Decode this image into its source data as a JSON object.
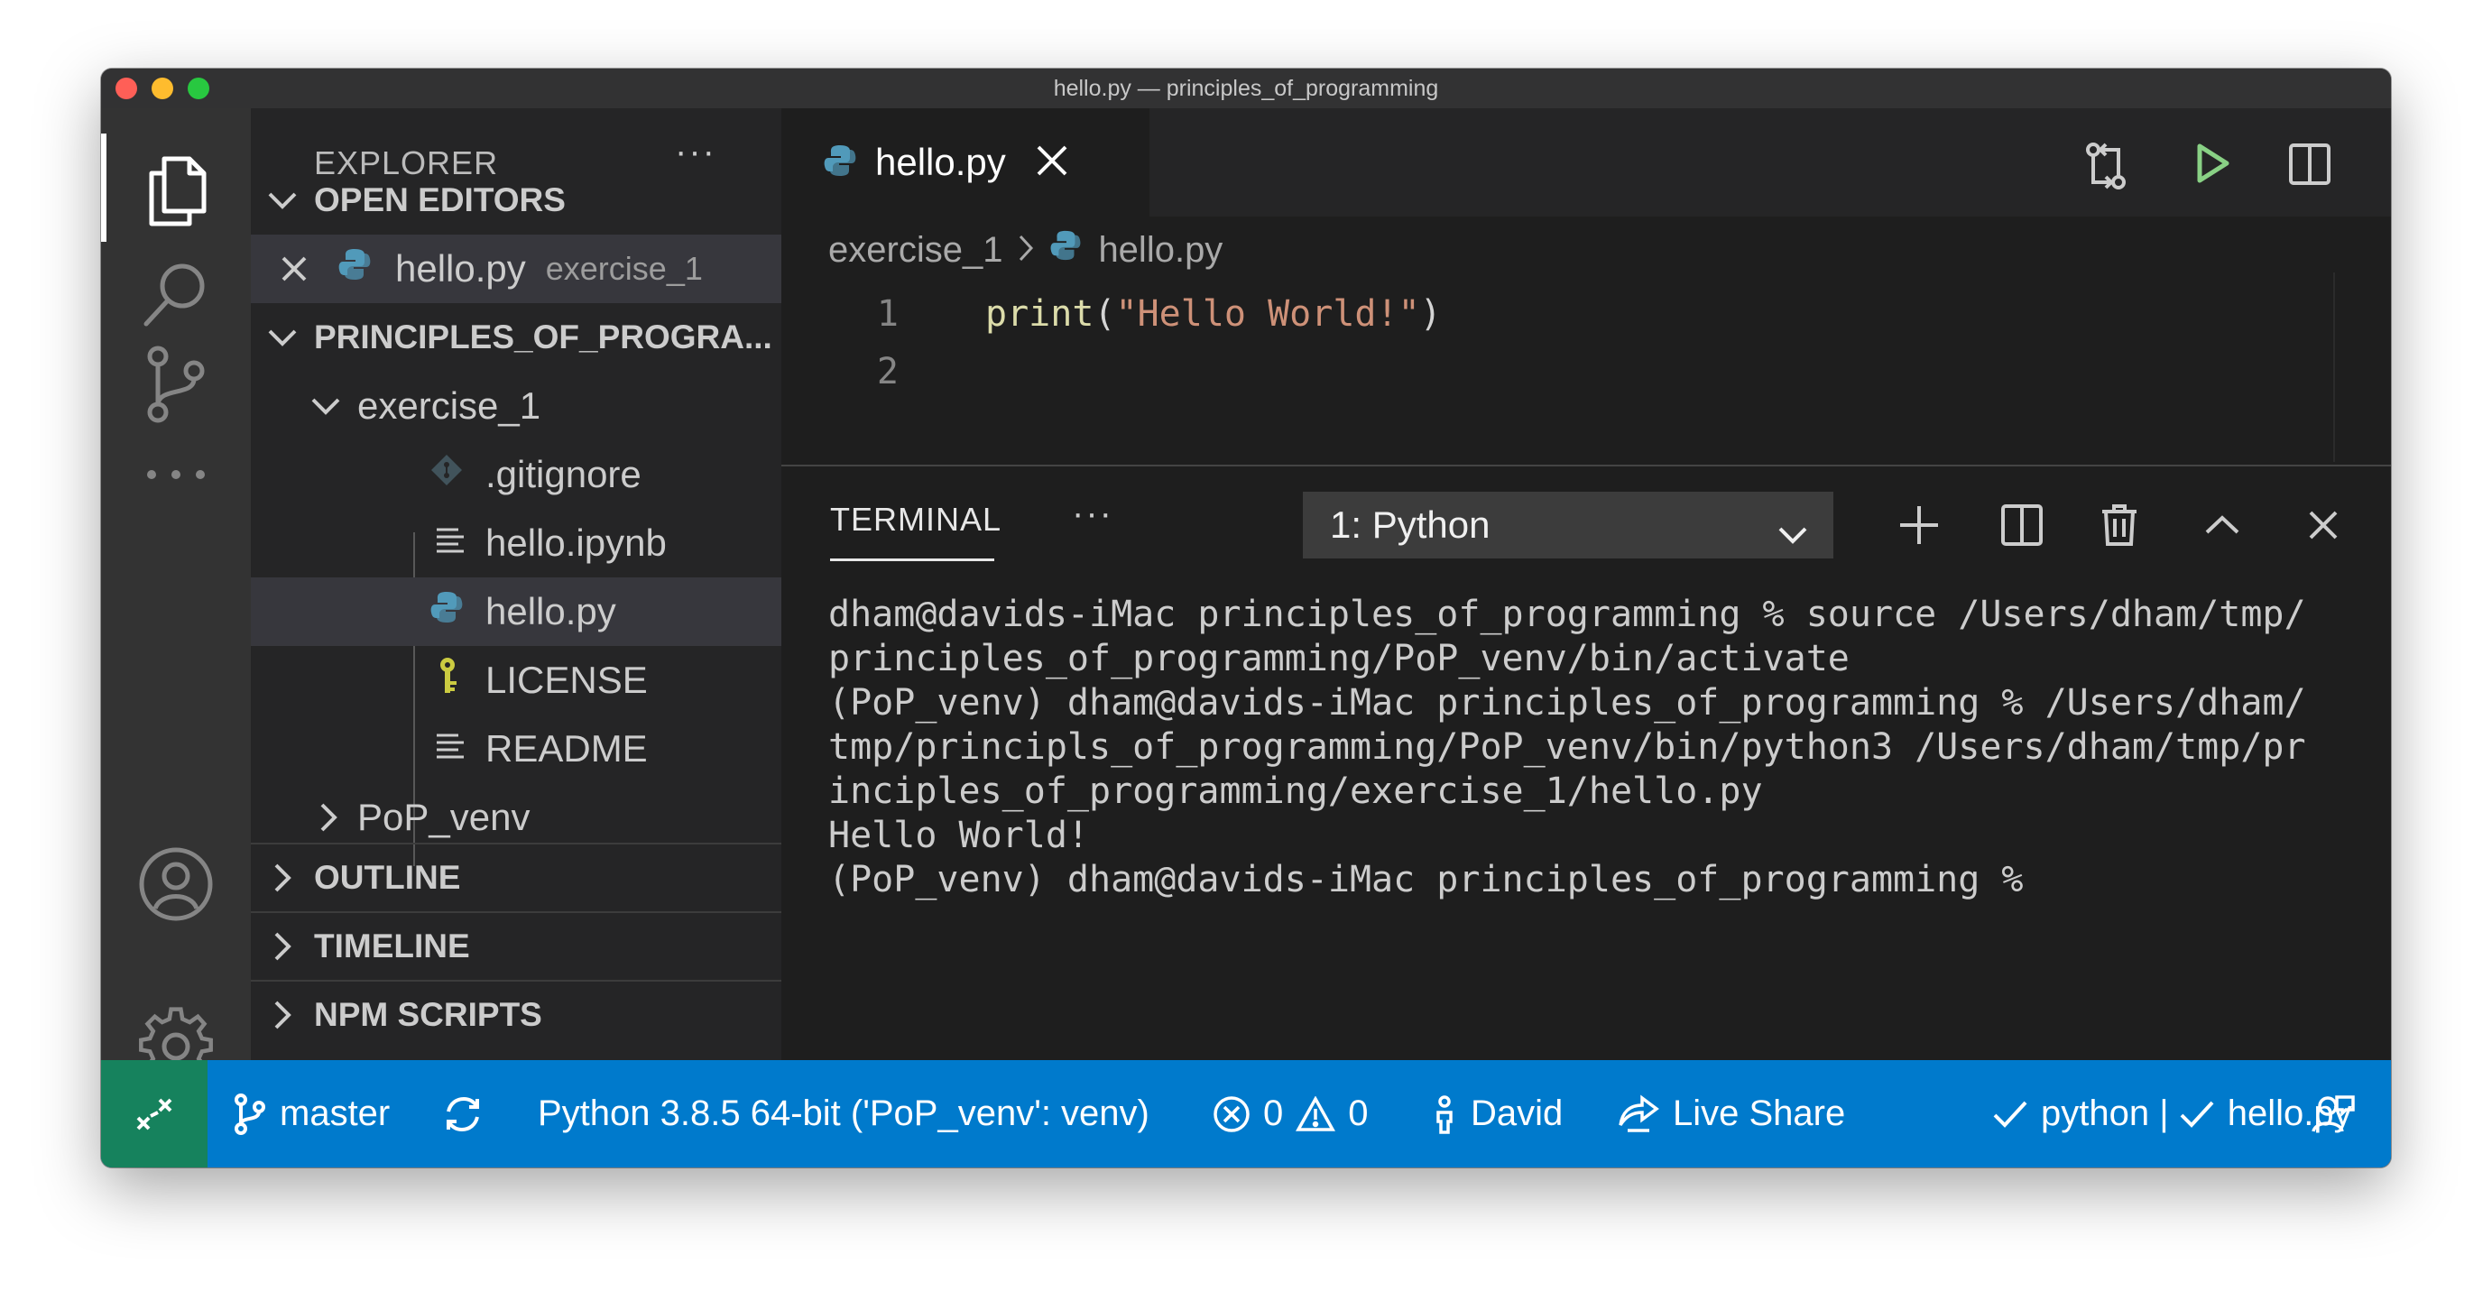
{
  "window": {
    "title": "hello.py — principles_of_programming"
  },
  "activity_bar": {
    "items": [
      "explorer",
      "search",
      "source-control",
      "more",
      "accounts",
      "manage"
    ]
  },
  "sidebar": {
    "title": "EXPLORER",
    "more": "···",
    "open_editors": {
      "title": "OPEN EDITORS",
      "items": [
        {
          "name": "hello.py",
          "folder": "exercise_1"
        }
      ]
    },
    "workspace": {
      "title": "PRINCIPLES_OF_PROGRA...",
      "folder": "exercise_1",
      "files": [
        ".gitignore",
        "hello.ipynb",
        "hello.py",
        "LICENSE",
        "README"
      ],
      "venv": "PoP_venv"
    },
    "sections": [
      "OUTLINE",
      "TIMELINE",
      "NPM SCRIPTS"
    ]
  },
  "editor": {
    "tab_label": "hello.py",
    "breadcrumb": [
      "exercise_1",
      "hello.py"
    ],
    "lines": [
      {
        "number": "1",
        "fn": "print",
        "open": "(",
        "str": "\"Hello World!\"",
        "close": ")"
      },
      {
        "number": "2"
      }
    ]
  },
  "panel": {
    "tab": "TERMINAL",
    "more": "···",
    "terminal_select": "1: Python",
    "terminal_lines": [
      "dham@davids-iMac principles_of_programming % source /Users/dham/tmp/",
      "principles_of_programming/PoP_venv/bin/activate",
      "(PoP_venv) dham@davids-iMac principles_of_programming % /Users/dham/",
      "tmp/principls_of_programming/PoP_venv/bin/python3 /Users/dham/tmp/pr",
      "inciples_of_programming/exercise_1/hello.py",
      "Hello World!",
      "(PoP_venv) dham@davids-iMac principles_of_programming %"
    ]
  },
  "statusbar": {
    "branch": "master",
    "interpreter": "Python 3.8.5 64-bit ('PoP_venv': venv)",
    "errors": "0",
    "warnings": "0",
    "user": "David",
    "live_share": "Live Share",
    "lint": "python | ",
    "file_check": "hello.py"
  },
  "colors": {
    "accent": "#007acc",
    "remote": "#16825d",
    "python_blue": "#519aba",
    "run_green": "#89d185"
  }
}
